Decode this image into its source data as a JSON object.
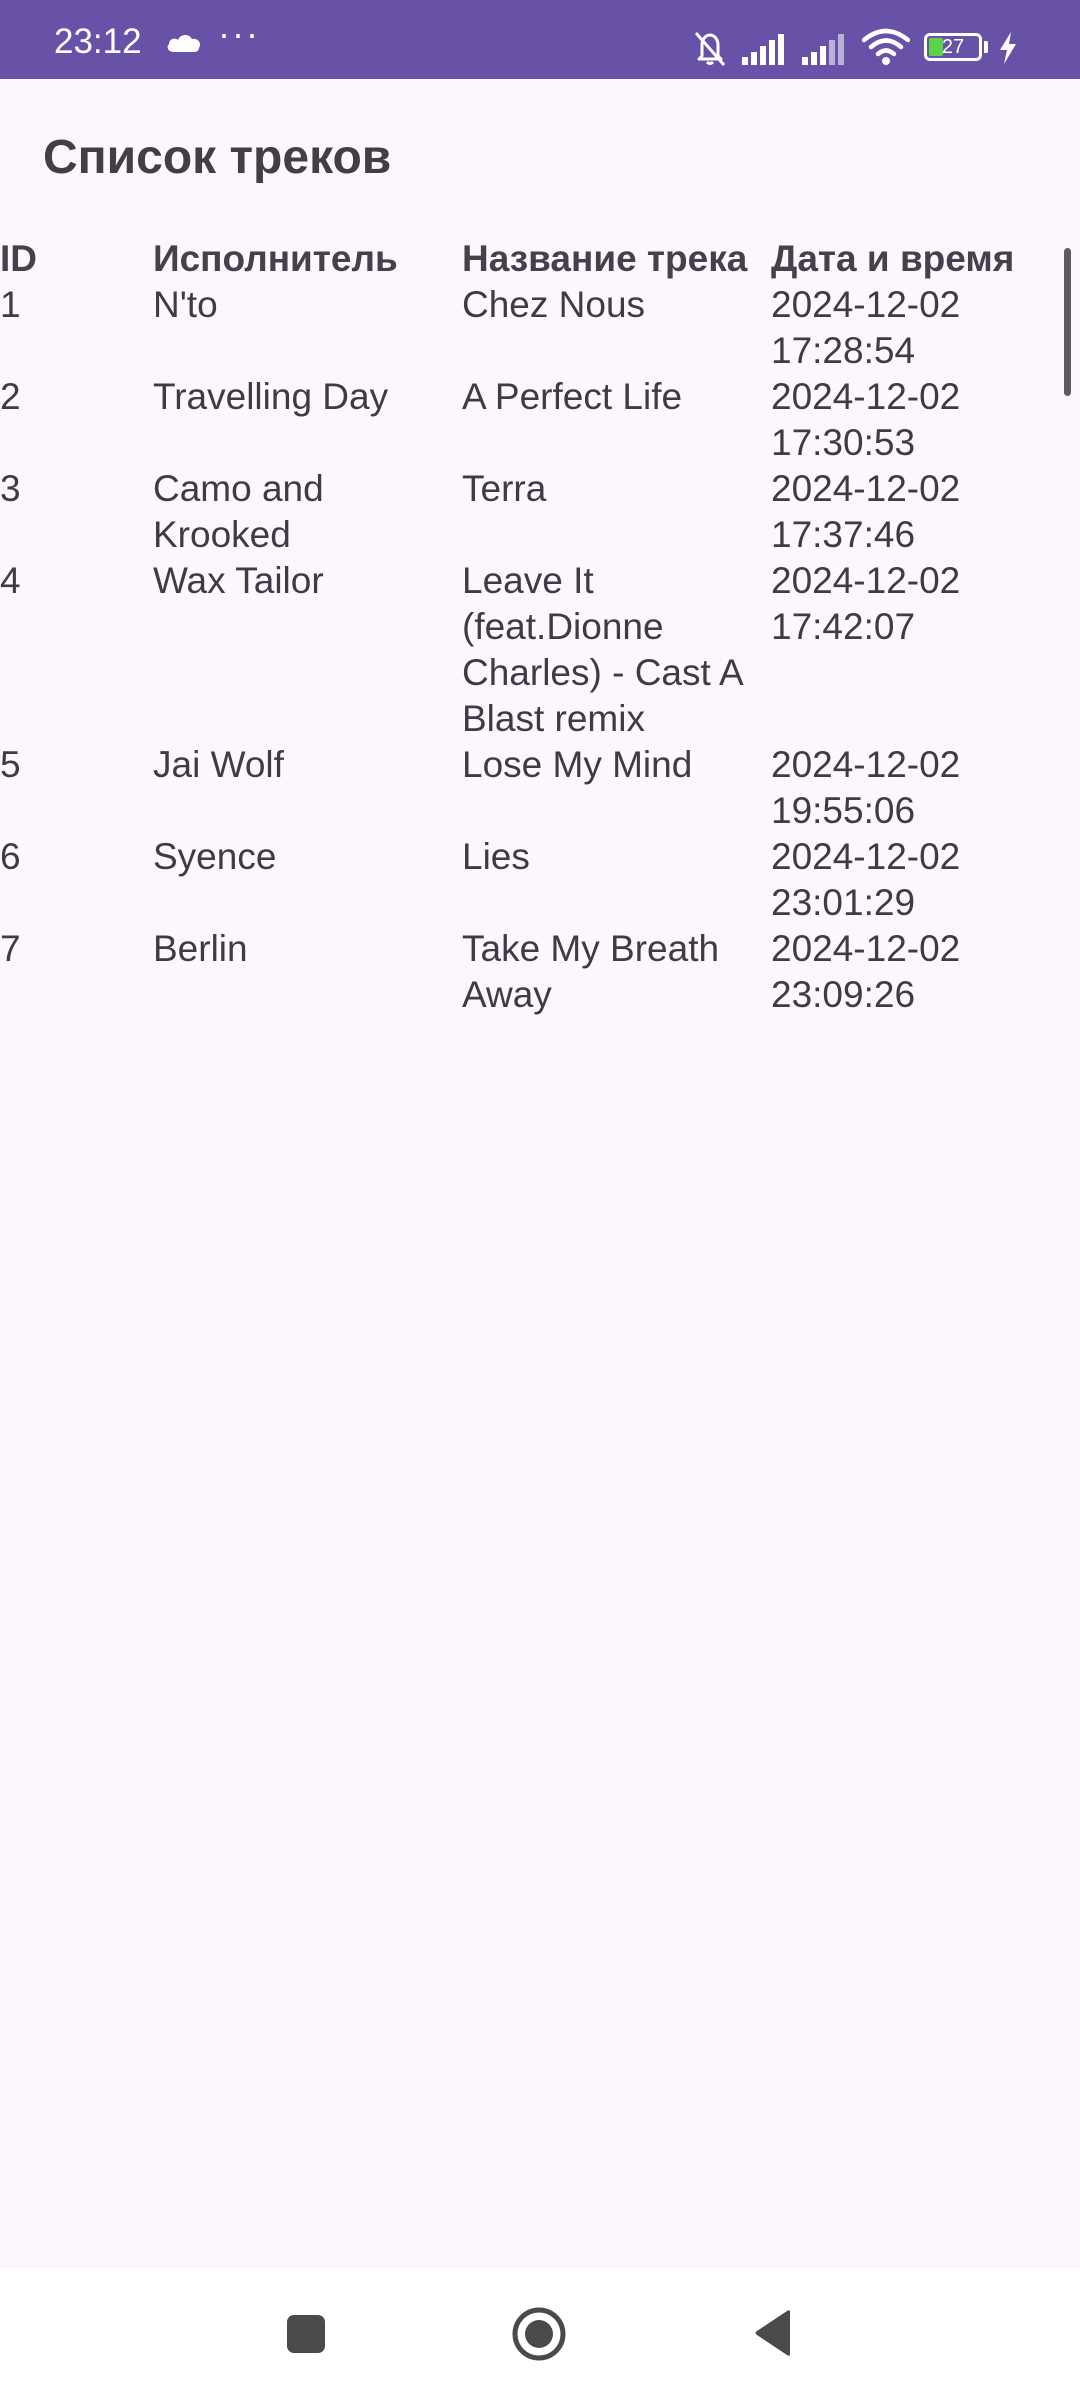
{
  "status_bar": {
    "time": "23:12",
    "more": "···",
    "battery_level": "27",
    "icons": [
      "cloud-icon",
      "bell-off-icon",
      "signal-icon",
      "signal-icon",
      "wifi-icon",
      "battery-icon",
      "charging-icon"
    ]
  },
  "page": {
    "title": "Список треков"
  },
  "table": {
    "headers": {
      "id": "ID",
      "artist": "Исполнитель",
      "title": "Название трека",
      "datetime": "Дата и время"
    },
    "rows": [
      {
        "id": "1",
        "artist": "N'to",
        "title": "Chez Nous",
        "datetime": "2024-12-02 17:28:54"
      },
      {
        "id": "2",
        "artist": "Travelling Day",
        "title": "A Perfect Life",
        "datetime": "2024-12-02 17:30:53"
      },
      {
        "id": "3",
        "artist": "Camo and Krooked",
        "title": "Terra",
        "datetime": "2024-12-02 17:37:46"
      },
      {
        "id": "4",
        "artist": "Wax Tailor",
        "title": "Leave It (feat.Dionne Charles) - Cast A Blast remix",
        "datetime": "2024-12-02 17:42:07"
      },
      {
        "id": "5",
        "artist": "Jai Wolf",
        "title": "Lose My Mind",
        "datetime": "2024-12-02 19:55:06"
      },
      {
        "id": "6",
        "artist": "Syence",
        "title": "Lies",
        "datetime": "2024-12-02 23:01:29"
      },
      {
        "id": "7",
        "artist": "Berlin",
        "title": "Take My Breath Away",
        "datetime": "2024-12-02 23:09:26"
      }
    ]
  },
  "nav_bar": {
    "icons": [
      "recents-icon",
      "home-icon",
      "back-icon"
    ]
  },
  "colors": {
    "status_bar": "#6852a8",
    "background": "#fdf7fd",
    "text": "#3f3a46"
  }
}
